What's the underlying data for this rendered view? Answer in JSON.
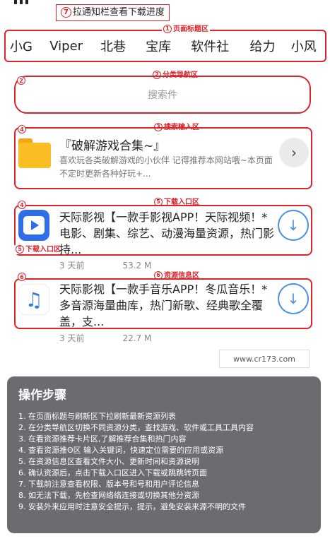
{
  "hint": {
    "num": "7",
    "text": "拉通知栏查看下载进度"
  },
  "tabs": [
    "小G",
    "Viper",
    "北巷",
    "宝库",
    "软件社",
    "给力",
    "小风"
  ],
  "tags": {
    "tabs": {
      "num": "1",
      "text": "页面标题区"
    },
    "nav": {
      "num": "2",
      "text": "分类导航区"
    },
    "search": {
      "num": "3",
      "text": "搜索输入区"
    },
    "download1": {
      "num": "5",
      "text": "下载入口区"
    },
    "download2": {
      "num": "5",
      "text": "下载入口区"
    },
    "resource": {
      "num": "6",
      "text": "资源信息区"
    },
    "lone_nav": "2",
    "lone_collection": "4",
    "lone_app1": "4",
    "lone_app2": "6"
  },
  "search": {
    "placeholder": "搜索件"
  },
  "collection": {
    "title": "『破解游戏合集~』",
    "desc": "喜欢玩各类破解游戏的小伙伴 记得推荐本网站哦~本页面不定时更新各种好玩+...",
    "arrow": "›"
  },
  "apps": [
    {
      "title": "天际影视【一款手影视APP！天际视频！*电影、剧集、综艺、动漫海量资源，热门影持...",
      "time": "3 天前",
      "size": "53.2 M",
      "icon": "video-app-icon"
    },
    {
      "title": "天际影视【一款手音乐APP！冬瓜音乐！*多音源海量曲库，热门新歌、经典歌全覆盖，支...",
      "time": "3 天前",
      "size": "22.7 M",
      "icon": "music-app-icon"
    }
  ],
  "site": "www.cr173.com",
  "steps": {
    "title": "操作步骤",
    "items": [
      "1. 在页面标题与刷新区下拉刷新最新资源列表",
      "2. 在分类导航区切换不同资源分类，查找游戏、软件或工具工具内容",
      "3. 在看资源推荐卡片区,了解推荐合集和热门内容",
      "4. 查看资源推ʘ区 输入关键词，快速定位需要的应用或资源",
      "5. 在资源信息区查看文件大小、更新时间和资源说明",
      "6. 确认资源后，点击下载入口区进入下载或跳跳转页面",
      "7. 下载前注意查看权限、版本号和号和用户评论信息",
      "8. 如无法下载，先检查网络络连接或切换其他分资源",
      "9. 安装外来应用时注意安全提示，提示，避免安装来源不明的文件"
    ]
  },
  "colors": {
    "annotation": "#d9252b",
    "accent": "#4a90e2",
    "panel": "#6b6b70"
  }
}
